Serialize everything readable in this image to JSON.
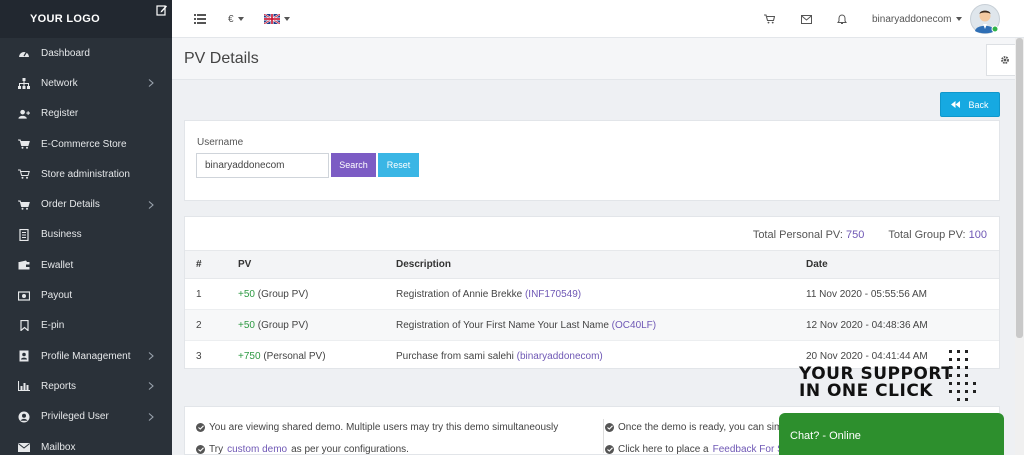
{
  "sidebar": {
    "logo": "YOUR LOGO",
    "items": [
      {
        "label": "Dashboard",
        "icon": "dashboard-icon",
        "has_sub": false
      },
      {
        "label": "Network",
        "icon": "network-icon",
        "has_sub": true
      },
      {
        "label": "Register",
        "icon": "user-plus-icon",
        "has_sub": false
      },
      {
        "label": "E-Commerce Store",
        "icon": "cart-icon",
        "has_sub": false
      },
      {
        "label": "Store administration",
        "icon": "cart-outline-icon",
        "has_sub": false
      },
      {
        "label": "Order Details",
        "icon": "cart-icon",
        "has_sub": true
      },
      {
        "label": "Business",
        "icon": "document-icon",
        "has_sub": false
      },
      {
        "label": "Ewallet",
        "icon": "wallet-icon",
        "has_sub": false
      },
      {
        "label": "Payout",
        "icon": "money-icon",
        "has_sub": false
      },
      {
        "label": "E-pin",
        "icon": "bookmark-icon",
        "has_sub": false
      },
      {
        "label": "Profile Management",
        "icon": "profile-icon",
        "has_sub": true
      },
      {
        "label": "Reports",
        "icon": "bar-chart-icon",
        "has_sub": true
      },
      {
        "label": "Privileged User",
        "icon": "user-circle-icon",
        "has_sub": true
      },
      {
        "label": "Mailbox",
        "icon": "envelope-icon",
        "has_sub": false
      }
    ]
  },
  "topbar": {
    "currency": "€",
    "username": "binaryaddonecom"
  },
  "page": {
    "title": "PV Details",
    "back_label": "Back"
  },
  "search": {
    "label": "Username",
    "value": "binaryaddonecom",
    "search_label": "Search",
    "reset_label": "Reset"
  },
  "totals": {
    "personal_label": "Total Personal PV:",
    "personal_value": "750",
    "group_label": "Total Group PV:",
    "group_value": "100"
  },
  "table": {
    "columns": [
      "#",
      "PV",
      "Description",
      "Date"
    ],
    "rows": [
      {
        "num": "1",
        "pv": "+50",
        "pv_type": "(Group PV)",
        "desc": "Registration of Annie Brekke",
        "ref": "(INF170549)",
        "date": "11 Nov 2020 - 05:55:56 AM"
      },
      {
        "num": "2",
        "pv": "+50",
        "pv_type": "(Group PV)",
        "desc": "Registration of Your First Name Your Last Name",
        "ref": "(OC40LF)",
        "date": "12 Nov 2020 - 04:48:36 AM"
      },
      {
        "num": "3",
        "pv": "+750",
        "pv_type": "(Personal PV)",
        "desc": "Purchase from sami salehi",
        "ref": "(binaryaddonecom)",
        "date": "20 Nov 2020 - 04:41:44 AM"
      }
    ]
  },
  "notice": {
    "line1": "You are viewing shared demo. Multiple users may try this demo simultaneously",
    "line2_pre": "Try",
    "line2_link": "custom demo",
    "line2_post": "as per your configurations.",
    "right1": "Once the demo is ready, you can simp",
    "right2_pre": "Click here to place a",
    "right2_link": "Feedback For Su"
  },
  "support": {
    "line1": "YOUR SUPPORT",
    "line2": "IN ONE CLICK"
  },
  "chat": {
    "label": "Chat? - Online"
  },
  "colors": {
    "sidebar_bg": "#2a3139",
    "accent_purple": "#7c5cc4",
    "accent_blue": "#16a9e1",
    "pv_green": "#2e9a43",
    "chat_green": "#2d8f2d"
  }
}
